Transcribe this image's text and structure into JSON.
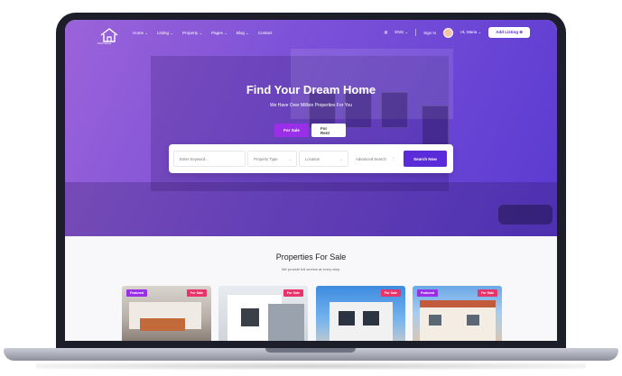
{
  "nav": {
    "logo_text": "Find House",
    "menu": [
      "Home ⌄",
      "Listing ⌄",
      "Property ⌄",
      "Pages ⌄",
      "Blog ⌄",
      "Contact"
    ],
    "language": "ENG ⌄",
    "signin": "Sign In",
    "user": "Hi, Maria ⌄",
    "add_listing": "Add Listing ⊕"
  },
  "hero": {
    "title": "Find Your Dream Home",
    "subtitle": "We Have Over Million Properties For You",
    "tabs": [
      "For Sale",
      "For Rent"
    ],
    "active_tab": "For Sale"
  },
  "search": {
    "keyword_placeholder": "Enter Keyword...",
    "property_type": "Property Type",
    "location": "Location",
    "advanced": "Advanced Search",
    "button": "Search Now"
  },
  "section": {
    "title": "Properties For Sale",
    "subtitle": "We provide full service at every step.",
    "cards": [
      {
        "featured": "Featured",
        "status": "For Sale"
      },
      {
        "featured": "",
        "status": "For Sale"
      },
      {
        "featured": "",
        "status": "For Sale"
      },
      {
        "featured": "Featured",
        "status": "For Sale"
      }
    ]
  },
  "colors": {
    "accent": "#5a2bd9",
    "sale_tab": "#9b2ee8",
    "sale_badge": "#e8336b"
  }
}
